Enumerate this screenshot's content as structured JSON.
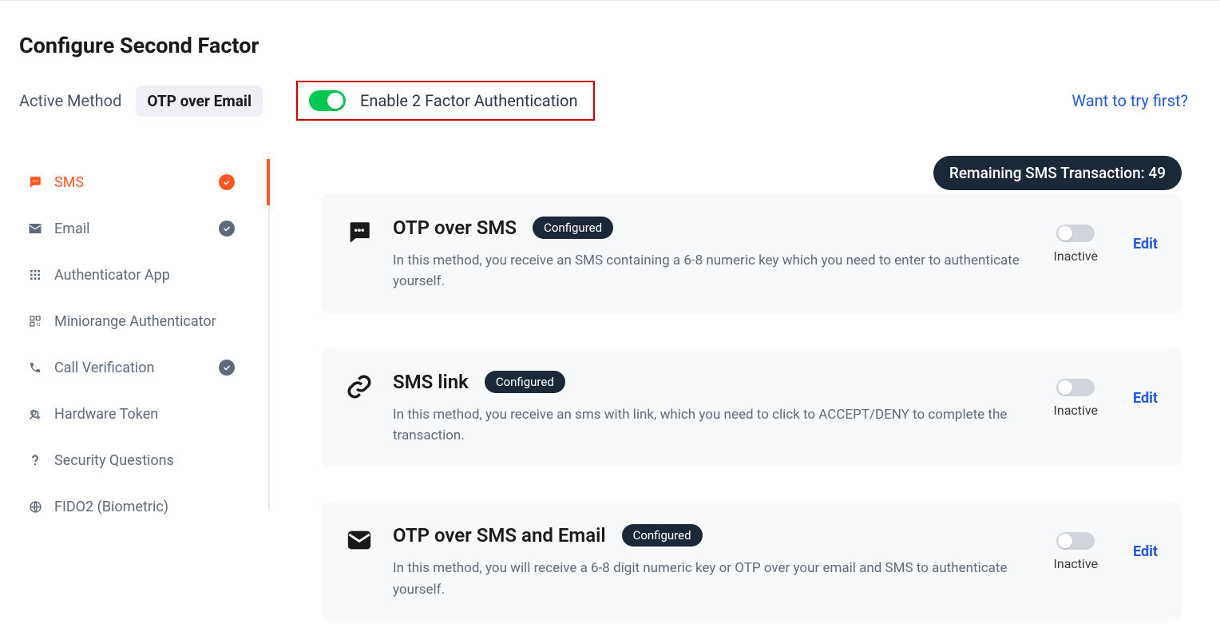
{
  "page_title": "Configure Second Factor",
  "header": {
    "active_method_label": "Active Method",
    "active_method_value": "OTP over Email",
    "enable_label": "Enable 2 Factor Authentication",
    "try_link": "Want to try first?"
  },
  "sidebar": {
    "items": [
      {
        "label": "SMS",
        "icon": "chat",
        "active": true,
        "checked": true,
        "check_color": "orange"
      },
      {
        "label": "Email",
        "icon": "mail",
        "active": false,
        "checked": true,
        "check_color": "gray"
      },
      {
        "label": "Authenticator App",
        "icon": "grid",
        "active": false,
        "checked": false
      },
      {
        "label": "Miniorange Authenticator",
        "icon": "qr",
        "active": false,
        "checked": false
      },
      {
        "label": "Call Verification",
        "icon": "phone",
        "active": false,
        "checked": true,
        "check_color": "gray"
      },
      {
        "label": "Hardware Token",
        "icon": "key",
        "active": false,
        "checked": false
      },
      {
        "label": "Security Questions",
        "icon": "question",
        "active": false,
        "checked": false
      },
      {
        "label": "FIDO2 (Biometric)",
        "icon": "globe",
        "active": false,
        "checked": false
      }
    ]
  },
  "sms_remaining": "Remaining SMS Transaction: 49",
  "methods": [
    {
      "icon": "chat-filled",
      "title": "OTP over SMS",
      "configured": "Configured",
      "desc": "In this method, you receive an SMS containing a 6-8 numeric key which you need to enter to authenticate yourself.",
      "status": "Inactive",
      "edit": "Edit"
    },
    {
      "icon": "link",
      "title": "SMS link",
      "configured": "Configured",
      "desc": "In this method, you receive an sms with link, which you need to click to ACCEPT/DENY to complete the transaction.",
      "status": "Inactive",
      "edit": "Edit"
    },
    {
      "icon": "mail-filled",
      "title": "OTP over SMS and Email",
      "configured": "Configured",
      "desc": "In this method, you will receive a 6-8 digit numeric key or OTP over your email and SMS to authenticate yourself.",
      "status": "Inactive",
      "edit": "Edit"
    }
  ]
}
